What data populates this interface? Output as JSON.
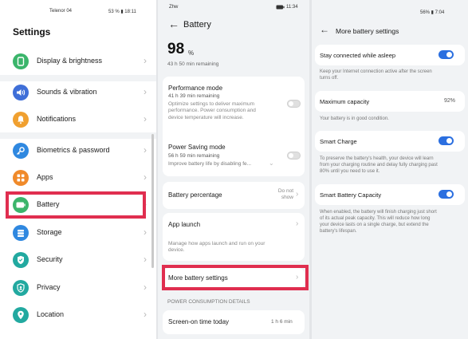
{
  "panel1": {
    "status": {
      "carrier": "Telenor 04",
      "right": "53 % ▮ 18:11"
    },
    "title": "Settings",
    "items": [
      {
        "label": "Display & brightness",
        "icon": "display-icon",
        "color": "#3bb56b"
      },
      {
        "label": "Sounds & vibration",
        "icon": "speaker-icon",
        "color": "#3f6fd8"
      },
      {
        "label": "Notifications",
        "icon": "bell-icon",
        "color": "#f0a030"
      },
      {
        "label": "Biometrics & password",
        "icon": "key-icon",
        "color": "#2f88e0"
      },
      {
        "label": "Apps",
        "icon": "apps-grid-icon",
        "color": "#f08a2a"
      },
      {
        "label": "Battery",
        "icon": "battery-icon",
        "color": "#3bb56b"
      },
      {
        "label": "Storage",
        "icon": "storage-icon",
        "color": "#2f88e0"
      },
      {
        "label": "Security",
        "icon": "shield-icon",
        "color": "#22a9a0"
      },
      {
        "label": "Privacy",
        "icon": "privacy-icon",
        "color": "#22a9a0"
      },
      {
        "label": "Location",
        "icon": "location-pin-icon",
        "color": "#22a9a0"
      }
    ],
    "highlight_color": "#e02e4f"
  },
  "panel2": {
    "status": {
      "left": "Zhw",
      "time": "11:34"
    },
    "title": "Battery",
    "percent": "98",
    "percent_symbol": "%",
    "remaining": "43 h 50 min remaining",
    "performance": {
      "title": "Performance mode",
      "sub": "41 h 39 min remaining",
      "desc": [
        "Optimize settings to deliver maximum",
        "performance. Power consumption and",
        "device temperature will increase."
      ]
    },
    "power_saving": {
      "title": "Power Saving mode",
      "sub": "56 h 59 min remaining",
      "desc": "Improve battery life by disabling fe..."
    },
    "battery_percentage": {
      "label": "Battery percentage",
      "value_line1": "Do not",
      "value_line2": "show"
    },
    "app_launch": {
      "label": "App launch",
      "desc": [
        "Manage how apps launch and run on your",
        "device."
      ]
    },
    "more_settings": {
      "label": "More battery settings"
    },
    "section_head": "POWER CONSUMPTION DETAILS",
    "screen_on": {
      "label": "Screen-on time today",
      "value": "1 h 6 min"
    }
  },
  "panel3": {
    "status": {
      "right": "56% ▮ 7:04"
    },
    "title": "More battery settings",
    "stay_connected": {
      "label": "Stay connected while asleep",
      "desc": [
        "Keep your Internet connection active after the screen",
        "turns off."
      ]
    },
    "max_capacity": {
      "label": "Maximum capacity",
      "value": "92%",
      "desc": "Your battery is in good condition."
    },
    "smart_charge": {
      "label": "Smart Charge",
      "desc": [
        "To preserve the battery's health, your device will learn",
        "from your charging routine and delay fully charging past",
        "80% until you need to use it."
      ]
    },
    "smart_capacity": {
      "label": "Smart Battery Capacity",
      "desc": [
        "When enabled, the battery will finish charging just short",
        "of its actual peak capacity. This will reduce how long",
        "your device lasts on a single charge, but extend the",
        "battery's lifespan."
      ]
    },
    "toggle_color": "#2b6fe0"
  }
}
